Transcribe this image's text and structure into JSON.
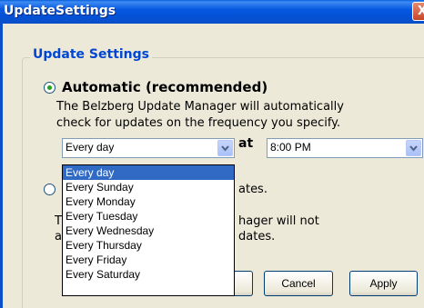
{
  "window": {
    "title": "UpdateSettings",
    "close_glyph": "X"
  },
  "group": {
    "label": "Update Settings"
  },
  "automatic": {
    "label": "Automatic (recommended)",
    "checked": true,
    "desc_line1": "The Belzberg Update Manager will automatically",
    "desc_line2": "check for updates on the frequency you specify."
  },
  "frequency": {
    "selected": "Every day",
    "options": [
      "Every day",
      "Every Sunday",
      "Every Monday",
      "Every Tuesday",
      "Every Wednesday",
      "Every Thursday",
      "Every Friday",
      "Every Saturday"
    ]
  },
  "time": {
    "at_label": "at",
    "selected": "8:00 PM"
  },
  "manual": {
    "checked": false,
    "partial1": "ates.",
    "partial2": "T",
    "partial3": "hager will not",
    "partial4": "a",
    "partial5": "dates."
  },
  "buttons": {
    "cancel": "Cancel",
    "apply": "Apply"
  },
  "colors": {
    "group_label": "#0046d5",
    "selection": "#316ac5",
    "titlebar": "#0858e0"
  }
}
